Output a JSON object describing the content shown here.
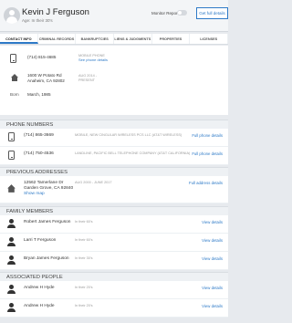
{
  "header": {
    "name": "Kevin J Ferguson",
    "age_line": "Age: In their 30's",
    "monitor_label": "Monitor Report",
    "get_full_label": "Get full details"
  },
  "tabs": [
    {
      "label": "CONTACT INFO",
      "active": true
    },
    {
      "label": "CRIMINAL RECORDS",
      "active": false
    },
    {
      "label": "BANKRUPTCIES",
      "active": false
    },
    {
      "label": "LIENS & JUDGMENTS",
      "active": false
    },
    {
      "label": "PROPERTIES",
      "active": false
    },
    {
      "label": "LICENSES",
      "active": false
    }
  ],
  "contact": {
    "phone": "(714) 815-4685",
    "phone_type": "MOBILE PHONE",
    "phone_link": "See phone details",
    "address_line1": "1600 W Potato Rd",
    "address_line2": "Anaheim, CA 92802",
    "address_dates": "AUG 2014 -",
    "address_status": "PRESENT",
    "born_label": "Born",
    "born_value": "March, 1985"
  },
  "phone_numbers": {
    "title": "PHONE NUMBERS",
    "items": [
      {
        "number": "(714) 865-3669",
        "carrier": "MOBILE, NEW CINGULAR WIRELESS PCS LLC (AT&T WIRELESS)",
        "action": "Full phone details"
      },
      {
        "number": "(714) 750-4536",
        "carrier": "LANDLINE, PACIFIC BELL TELEPHONE COMPANY (AT&T CALIFORNIA)",
        "action": "Full phone details"
      }
    ]
  },
  "previous_addresses": {
    "title": "PREVIOUS ADDRESSES",
    "items": [
      {
        "line1": "12562 Tamerlane Dr",
        "line2": "Garden Grove, CA 92840",
        "show_map": "Show map",
        "dates": "AUG 2000 - JUNE 2017",
        "action": "Full address details"
      }
    ]
  },
  "family": {
    "title": "FAMILY MEMBERS",
    "items": [
      {
        "name": "Robert James Ferguson",
        "age": "In their 60's",
        "action": "View details"
      },
      {
        "name": "Larri T Ferguson",
        "age": "In their 60's",
        "action": "View details"
      },
      {
        "name": "Bryan James Ferguson",
        "age": "In their 30's",
        "action": "View details"
      }
    ]
  },
  "associated": {
    "title": "ASSOCIATED PEOPLE",
    "items": [
      {
        "name": "Andrew H Hyde",
        "age": "In their 20's",
        "action": "View details"
      },
      {
        "name": "Andrew H Hyde",
        "age": "In their 20's",
        "action": "View details"
      }
    ]
  }
}
